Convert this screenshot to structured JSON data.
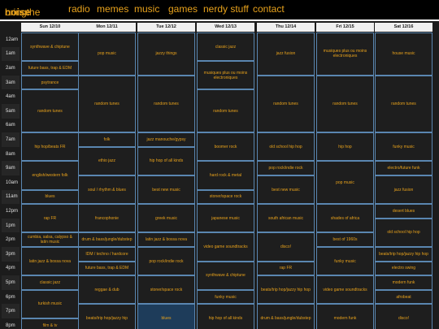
{
  "nav": {
    "brand_a": "bringthe",
    "brand_b": "noise",
    "links": [
      "radio",
      "memes",
      "music",
      "games",
      "nerdy stuff",
      "contact"
    ]
  },
  "schedule": {
    "days": [
      "Sun 12/10",
      "Mon 12/11",
      "Tue 12/12",
      "Wed 12/13",
      "Thu 12/14",
      "Fri 12/15",
      "Sat 12/16"
    ],
    "times": [
      "12am",
      "1am",
      "2am",
      "3am",
      "4am",
      "5am",
      "6am",
      "7am",
      "8am",
      "9am",
      "10am",
      "11am",
      "12pm",
      "1pm",
      "2pm",
      "3pm",
      "4pm",
      "5pm",
      "6pm",
      "7pm",
      "8pm"
    ],
    "columns": [
      [
        {
          "label": "synthwave & chiptune",
          "start": 0,
          "len": 2
        },
        {
          "label": "future bass, trap & EDM",
          "start": 2,
          "len": 1
        },
        {
          "label": "psytrance",
          "start": 3,
          "len": 1
        },
        {
          "label": "random tunes",
          "start": 4,
          "len": 3
        },
        {
          "label": "hip hop/beats FR",
          "start": 7,
          "len": 2
        },
        {
          "label": "english/western folk",
          "start": 9,
          "len": 2
        },
        {
          "label": "blues",
          "start": 11,
          "len": 1
        },
        {
          "label": "rap FR",
          "start": 12,
          "len": 2
        },
        {
          "label": "cumbia, salsa, calypso & latin music",
          "start": 14,
          "len": 1
        },
        {
          "label": "latin jazz & bossa nova",
          "start": 15,
          "len": 2
        },
        {
          "label": "classic jazz",
          "start": 17,
          "len": 1
        },
        {
          "label": "turkish music",
          "start": 18,
          "len": 2
        },
        {
          "label": "film & tv",
          "start": 20,
          "len": 1
        }
      ],
      [
        {
          "label": "pop music",
          "start": 0,
          "len": 3
        },
        {
          "label": "random tunes",
          "start": 3,
          "len": 4
        },
        {
          "label": "folk",
          "start": 7,
          "len": 1
        },
        {
          "label": "ethio jazz",
          "start": 8,
          "len": 2
        },
        {
          "label": "soul / rhythm & blues",
          "start": 10,
          "len": 2
        },
        {
          "label": "francophonie",
          "start": 12,
          "len": 2
        },
        {
          "label": "drum & bass/jungle/dubstep",
          "start": 14,
          "len": 1
        },
        {
          "label": "IDM / techno / hardcore",
          "start": 15,
          "len": 1
        },
        {
          "label": "future bass, trap & EDM",
          "start": 16,
          "len": 1
        },
        {
          "label": "tribal / afro bass /",
          "start": 17,
          "len": 1
        },
        {
          "label": "reggae & dub",
          "start": 17,
          "len": 2
        },
        {
          "label": "beats/trip hop/jazzy hip",
          "start": 19,
          "len": 2
        }
      ],
      [
        {
          "label": "jazzy things",
          "start": 0,
          "len": 3
        },
        {
          "label": "random tunes",
          "start": 3,
          "len": 4
        },
        {
          "label": "jazz manouche/gypsy",
          "start": 7,
          "len": 1
        },
        {
          "label": "hip hop of all kinds",
          "start": 8,
          "len": 2
        },
        {
          "label": "best new music",
          "start": 10,
          "len": 2
        },
        {
          "label": "greek music",
          "start": 12,
          "len": 2
        },
        {
          "label": "latin jazz & bossa nova",
          "start": 14,
          "len": 1
        },
        {
          "label": "pop rock/indie rock",
          "start": 15,
          "len": 2
        },
        {
          "label": "stoner/space rock",
          "start": 17,
          "len": 2
        },
        {
          "label": "blues",
          "start": 19,
          "len": 2,
          "hl": true
        }
      ],
      [
        {
          "label": "classic jazz",
          "start": 0,
          "len": 2
        },
        {
          "label": "musiques plus ou moins electroniques",
          "start": 2,
          "len": 2
        },
        {
          "label": "random tunes",
          "start": 4,
          "len": 3
        },
        {
          "label": "boomer rock",
          "start": 7,
          "len": 2
        },
        {
          "label": "hard rock & metal",
          "start": 9,
          "len": 2
        },
        {
          "label": "stoner/space rock",
          "start": 11,
          "len": 1
        },
        {
          "label": "japanese music",
          "start": 12,
          "len": 2
        },
        {
          "label": "video game soundtracks",
          "start": 14,
          "len": 2
        },
        {
          "label": "synthwave & chiptune",
          "start": 16,
          "len": 2
        },
        {
          "label": "funky music",
          "start": 18,
          "len": 1
        },
        {
          "label": "hip hop of all kinds",
          "start": 19,
          "len": 2
        }
      ],
      [
        {
          "label": "jazz fusion",
          "start": 0,
          "len": 3
        },
        {
          "label": "random tunes",
          "start": 3,
          "len": 4
        },
        {
          "label": "old school hip hop",
          "start": 7,
          "len": 2
        },
        {
          "label": "pop rock/indie rock",
          "start": 9,
          "len": 1
        },
        {
          "label": "best new music",
          "start": 10,
          "len": 2
        },
        {
          "label": "south african music",
          "start": 12,
          "len": 2
        },
        {
          "label": "disco!",
          "start": 14,
          "len": 2
        },
        {
          "label": "rap FR",
          "start": 16,
          "len": 1
        },
        {
          "label": "beats/trip hop/jazzy hip hop",
          "start": 17,
          "len": 2
        },
        {
          "label": "drum & bass/jungle/dubstep",
          "start": 19,
          "len": 2
        }
      ],
      [
        {
          "label": "musiques plus ou moins electroniques",
          "start": 0,
          "len": 3
        },
        {
          "label": "random tunes",
          "start": 3,
          "len": 4
        },
        {
          "label": "hip hop",
          "start": 7,
          "len": 2
        },
        {
          "label": "pop music",
          "start": 9,
          "len": 3
        },
        {
          "label": "shades of africa",
          "start": 12,
          "len": 2
        },
        {
          "label": "best of 1960s",
          "start": 14,
          "len": 1
        },
        {
          "label": "funky music",
          "start": 15,
          "len": 2
        },
        {
          "label": "video game soundtracks",
          "start": 17,
          "len": 2
        },
        {
          "label": "modern funk",
          "start": 19,
          "len": 2
        }
      ],
      [
        {
          "label": "house music",
          "start": 0,
          "len": 3
        },
        {
          "label": "random tunes",
          "start": 3,
          "len": 4
        },
        {
          "label": "funky music",
          "start": 7,
          "len": 2
        },
        {
          "label": "electro/future funk",
          "start": 9,
          "len": 1
        },
        {
          "label": "jazz fusion",
          "start": 10,
          "len": 2
        },
        {
          "label": "desert blues",
          "start": 12,
          "len": 1
        },
        {
          "label": "old school hip hop",
          "start": 13,
          "len": 2
        },
        {
          "label": "beats/trip hop/jazzy hip hop",
          "start": 15,
          "len": 1
        },
        {
          "label": "electro swing",
          "start": 16,
          "len": 1
        },
        {
          "label": "modern funk",
          "start": 17,
          "len": 1
        },
        {
          "label": "afrobeat",
          "start": 18,
          "len": 1
        },
        {
          "label": "disco!",
          "start": 19,
          "len": 2
        }
      ]
    ]
  },
  "colors": {
    "accent": "#e8a21c",
    "cell_border": "#5a86b0",
    "highlight": "#1e3c5a"
  }
}
